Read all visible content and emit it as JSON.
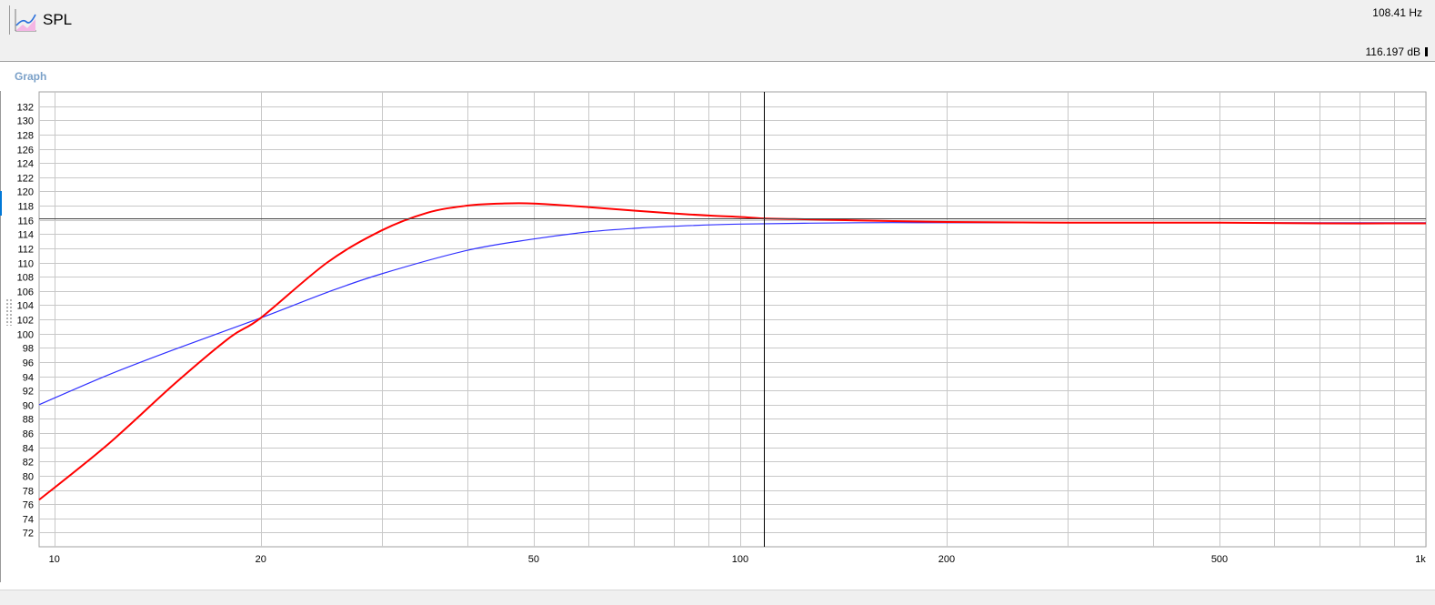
{
  "toolbar": {
    "title": "SPL",
    "icon": "spl-graph-icon"
  },
  "readout": {
    "frequency": "108.41 Hz",
    "level": "116.197 dB"
  },
  "panel": {
    "label": "Graph"
  },
  "colors": {
    "series_red": "#ff0000",
    "series_blue": "#3030ff",
    "grid": "#c8c8c8",
    "cursor": "#000000",
    "panel_label": "#7aa0c8"
  },
  "chart_data": {
    "type": "line",
    "title": "",
    "xlabel": "",
    "ylabel": "",
    "x_scale": "log",
    "xlim": [
      9.5,
      1000
    ],
    "ylim": [
      70,
      134
    ],
    "grid": true,
    "x_ticks": [
      10,
      20,
      50,
      100,
      200,
      500,
      1000
    ],
    "x_tick_labels": [
      "10",
      "20",
      "50",
      "100",
      "200",
      "500",
      "1k"
    ],
    "y_ticks": [
      72,
      74,
      76,
      78,
      80,
      82,
      84,
      86,
      88,
      90,
      92,
      94,
      96,
      98,
      100,
      102,
      104,
      106,
      108,
      110,
      112,
      114,
      116,
      118,
      120,
      122,
      124,
      126,
      128,
      130,
      132
    ],
    "cursor": {
      "x": 108.41,
      "y": 116.197
    },
    "series": [
      {
        "color": "#ff0000",
        "x": [
          9.5,
          12,
          15,
          18,
          20,
          25,
          30,
          35,
          40,
          45,
          50,
          60,
          70,
          80,
          90,
          100,
          108,
          120,
          150,
          200,
          300,
          500,
          700,
          1000
        ],
        "y": [
          76.6,
          84.5,
          93.0,
          99.4,
          102.2,
          110.0,
          114.5,
          117.0,
          118.0,
          118.3,
          118.3,
          117.8,
          117.3,
          116.9,
          116.6,
          116.4,
          116.2,
          116.1,
          115.9,
          115.7,
          115.6,
          115.6,
          115.5,
          115.5
        ]
      },
      {
        "color": "#3030ff",
        "x": [
          9.5,
          12,
          15,
          20,
          25,
          30,
          40,
          50,
          60,
          70,
          80,
          100,
          150,
          200,
          300,
          500,
          1000
        ],
        "y": [
          90.0,
          94.2,
          97.8,
          102.2,
          105.8,
          108.4,
          111.7,
          113.3,
          114.3,
          114.8,
          115.1,
          115.4,
          115.6,
          115.6,
          115.6,
          115.6,
          115.6
        ]
      }
    ]
  }
}
